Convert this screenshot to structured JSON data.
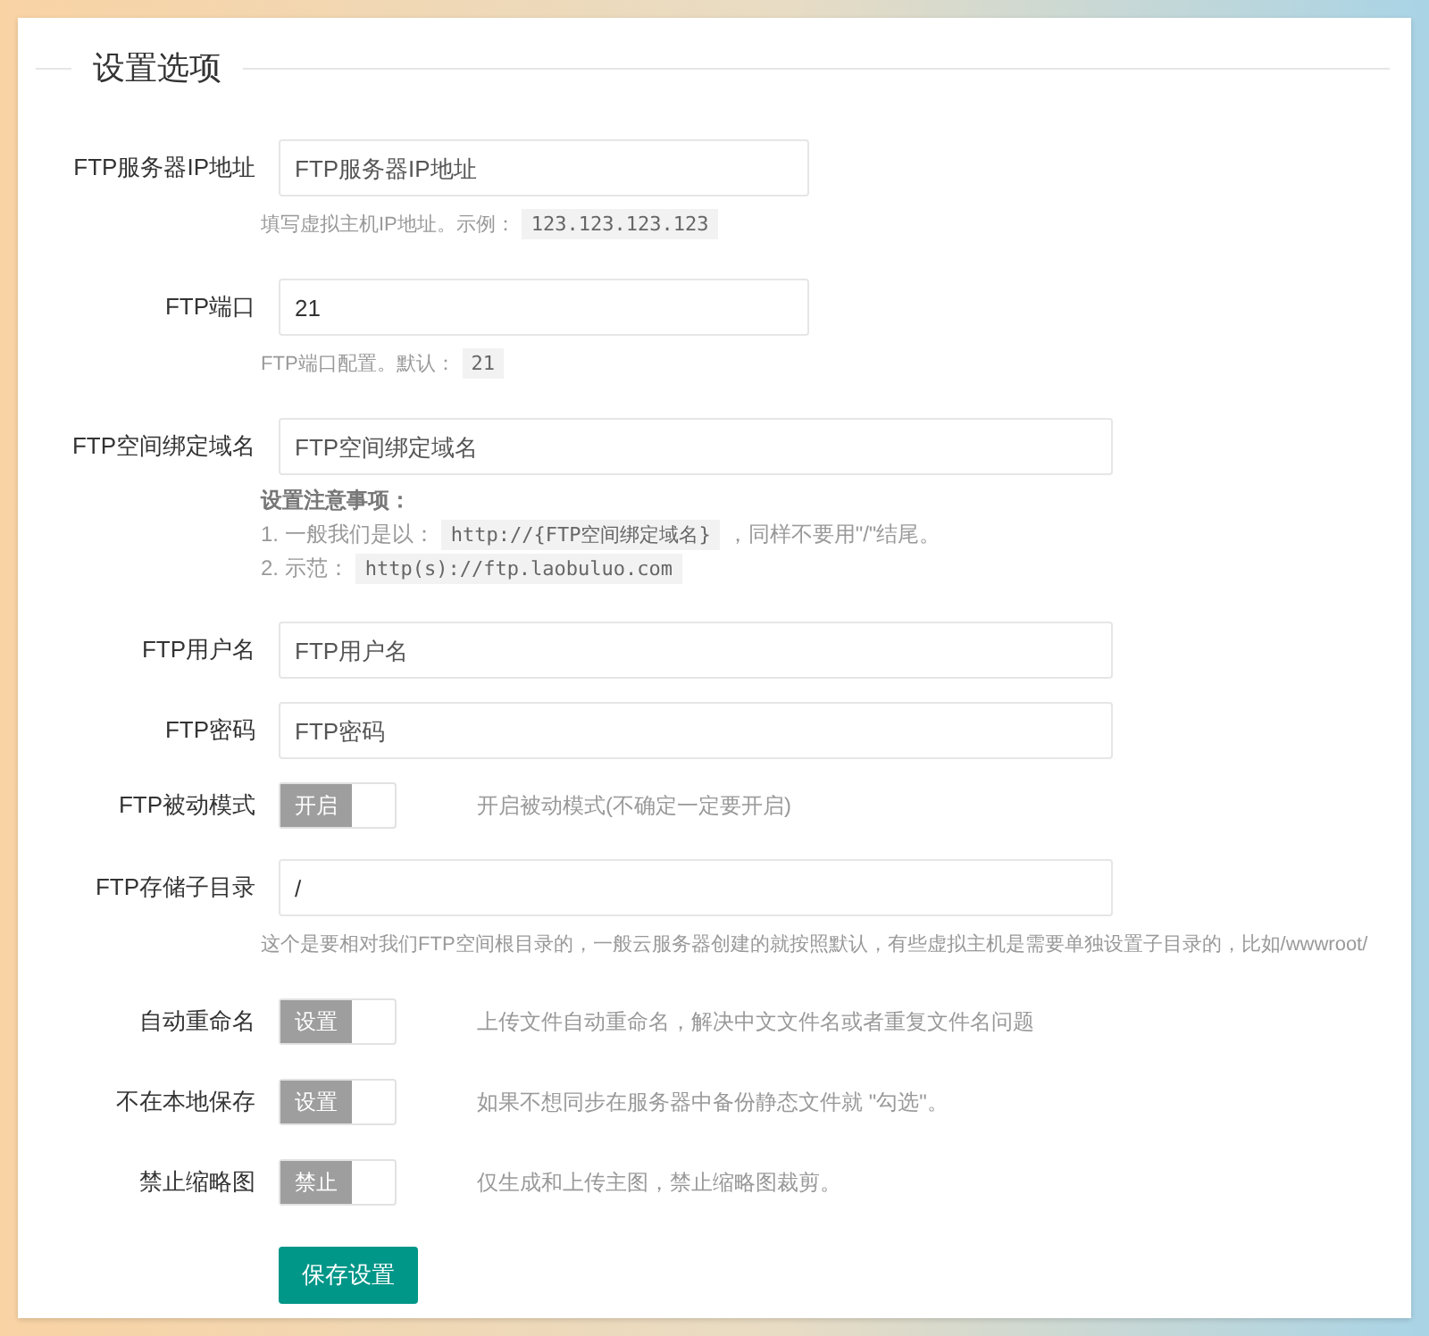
{
  "section_title": "设置选项",
  "fields": [
    {
      "kind": "input",
      "label": "FTP服务器IP地址",
      "placeholder": "FTP服务器IP地址",
      "help": [
        {
          "kind": "text",
          "text": "填写虚拟主机IP地址。示例："
        },
        {
          "kind": "code",
          "text": "123.123.123.123"
        }
      ]
    },
    {
      "kind": "input",
      "label": "FTP端口",
      "value": "21",
      "help": [
        {
          "kind": "text",
          "text": "FTP端口配置。默认："
        },
        {
          "kind": "code",
          "text": "21"
        }
      ]
    },
    {
      "kind": "input",
      "label": "FTP空间绑定域名",
      "placeholder": "FTP空间绑定域名",
      "notes": {
        "title": "设置注意事项：",
        "lines": [
          [
            {
              "kind": "text",
              "text": "1. 一般我们是以："
            },
            {
              "kind": "code",
              "text": "http://{FTP空间绑定域名}"
            },
            {
              "kind": "text",
              "text": "，同样不要用\"/\"结尾。"
            }
          ],
          [
            {
              "kind": "text",
              "text": "2. 示范："
            },
            {
              "kind": "code",
              "text": "http(s)://ftp.laobuluo.com"
            }
          ]
        ]
      }
    },
    {
      "kind": "input",
      "label": "FTP用户名",
      "placeholder": "FTP用户名"
    },
    {
      "kind": "input",
      "label": "FTP密码",
      "placeholder": "FTP密码"
    },
    {
      "kind": "switch",
      "label": "FTP被动模式",
      "switch_text": "开启",
      "on": false,
      "description": "开启被动模式(不确定一定要开启)"
    },
    {
      "kind": "input",
      "label": "FTP存储子目录",
      "value": "/",
      "help": [
        {
          "kind": "text",
          "text": "这个是要相对我们FTP空间根目录的，一般云服务器创建的就按照默认，有些虚拟主机是需要单独设置子目录的，比如/wwwroot/"
        }
      ]
    },
    {
      "kind": "switch",
      "label": "自动重命名",
      "switch_text": "设置",
      "on": false,
      "description": "上传文件自动重命名，解决中文文件名或者重复文件名问题"
    },
    {
      "kind": "switch",
      "label": "不在本地保存",
      "switch_text": "设置",
      "on": false,
      "description": "如果不想同步在服务器中备份静态文件就 \"勾选\"。"
    },
    {
      "kind": "switch",
      "label": "禁止缩略图",
      "switch_text": "禁止",
      "on": false,
      "description": "仅生成和上传主图，禁止缩略图裁剪。"
    }
  ],
  "submit_button": "保存设置"
}
